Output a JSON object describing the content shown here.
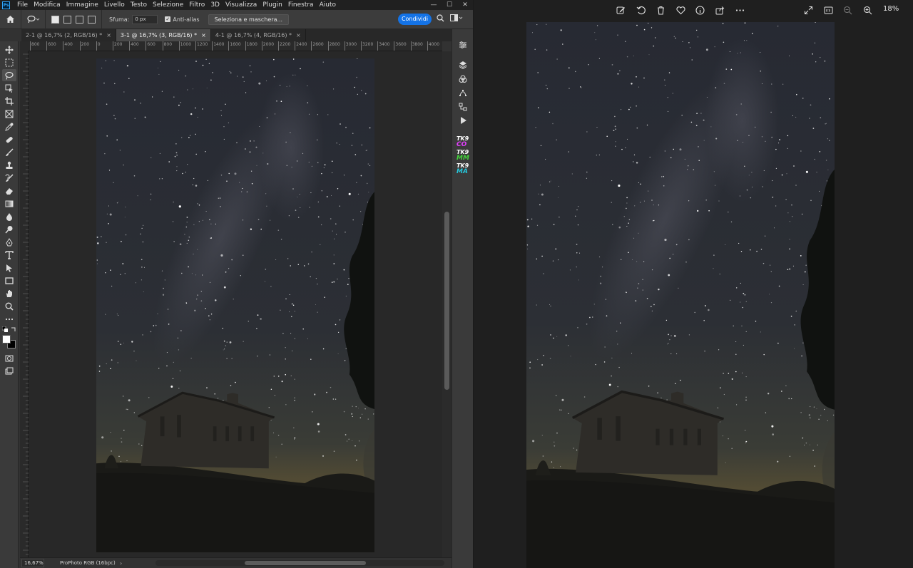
{
  "photoshop": {
    "logo": "Ps",
    "menu": [
      "File",
      "Modifica",
      "Immagine",
      "Livello",
      "Testo",
      "Selezione",
      "Filtro",
      "3D",
      "Visualizza",
      "Plugin",
      "Finestra",
      "Aiuto"
    ],
    "window_controls": [
      "—",
      "☐",
      "✕"
    ],
    "options": {
      "feather_label": "Sfuma:",
      "feather_value": "0 px",
      "antialias_label": "Anti-alias",
      "select_mask_label": "Seleziona e maschera...",
      "share_label": "Condividi"
    },
    "tabs": [
      {
        "label": "2-1 @ 16,7% (2, RGB/16) *",
        "active": false
      },
      {
        "label": "3-1 @ 16,7% (3, RGB/16) *",
        "active": true
      },
      {
        "label": "4-1 @ 16,7% (4, RGB/16) *",
        "active": false
      }
    ],
    "tab_close": "×",
    "ruler_labels": [
      "800",
      "600",
      "400",
      "200",
      "0",
      "200",
      "400",
      "600",
      "800",
      "1000",
      "1200",
      "1400",
      "1600",
      "1800",
      "2000",
      "2200",
      "2400",
      "2600",
      "2800",
      "3000",
      "3200",
      "3400",
      "3600",
      "3800",
      "4000"
    ],
    "status": {
      "zoom": "16,67%",
      "profile": "ProPhoto RGB (16bpc)",
      "arrow": "›"
    },
    "plugins": [
      {
        "top": "TK9",
        "bottom": "CO",
        "color": "#e040fb"
      },
      {
        "top": "TK9",
        "bottom": "MM",
        "color": "#43d13b"
      },
      {
        "top": "TK9",
        "bottom": "MA",
        "color": "#26c6da"
      }
    ]
  },
  "viewer": {
    "zoom_level": "18%",
    "icons": [
      "edit-icon",
      "rotate-icon",
      "delete-icon",
      "favorite-icon",
      "info-icon",
      "share-icon",
      "more-icon",
      "fullscreen-icon",
      "actual-size-icon",
      "zoom-out-icon",
      "zoom-in-icon"
    ]
  }
}
